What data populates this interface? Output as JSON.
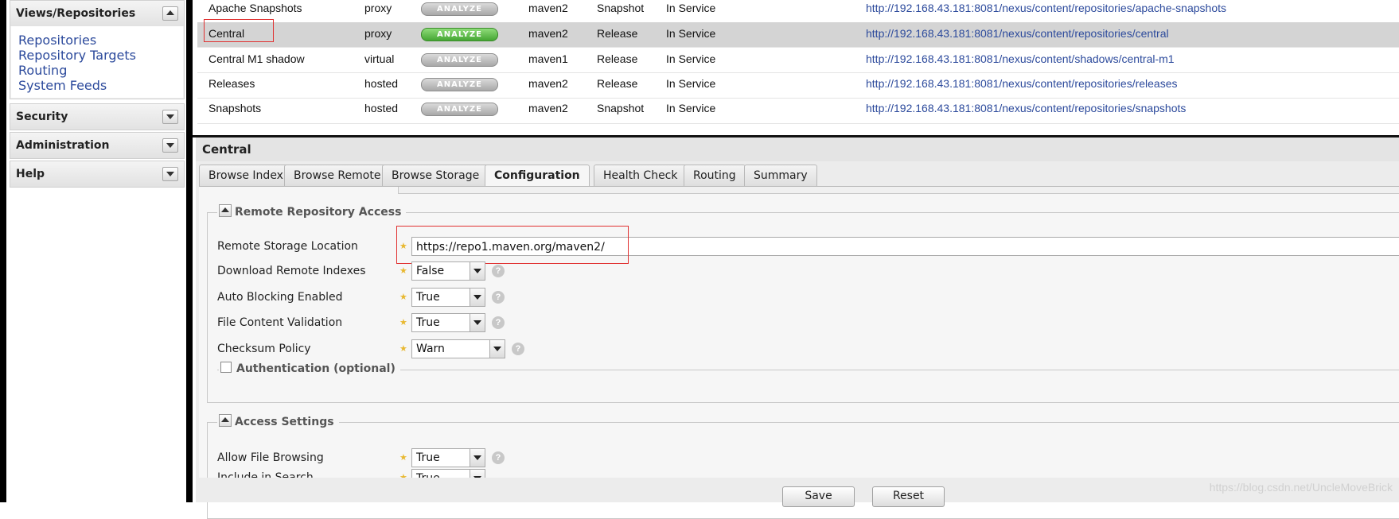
{
  "sidebar": {
    "panels": [
      {
        "title": "Views/Repositories",
        "links": [
          "Repositories",
          "Repository Targets",
          "Routing",
          "System Feeds"
        ]
      },
      {
        "title": "Security"
      },
      {
        "title": "Administration"
      },
      {
        "title": "Help"
      }
    ]
  },
  "repos": {
    "analyze_label": "ANALYZE",
    "rows": [
      {
        "name": "Apache Snapshots",
        "type": "proxy",
        "format": "maven2",
        "policy": "Snapshot",
        "status": "In Service",
        "url": "http://192.168.43.181:8081/nexus/content/repositories/apache-snapshots"
      },
      {
        "name": "Central",
        "type": "proxy",
        "format": "maven2",
        "policy": "Release",
        "status": "In Service",
        "url": "http://192.168.43.181:8081/nexus/content/repositories/central"
      },
      {
        "name": "Central M1 shadow",
        "type": "virtual",
        "format": "maven1",
        "policy": "Release",
        "status": "In Service",
        "url": "http://192.168.43.181:8081/nexus/content/shadows/central-m1"
      },
      {
        "name": "Releases",
        "type": "hosted",
        "format": "maven2",
        "policy": "Release",
        "status": "In Service",
        "url": "http://192.168.43.181:8081/nexus/content/repositories/releases"
      },
      {
        "name": "Snapshots",
        "type": "hosted",
        "format": "maven2",
        "policy": "Snapshot",
        "status": "In Service",
        "url": "http://192.168.43.181:8081/nexus/content/repositories/snapshots"
      }
    ]
  },
  "detail": {
    "title": "Central",
    "tabs": [
      "Browse Index",
      "Browse Remote",
      "Browse Storage",
      "Configuration",
      "Health Check",
      "Routing",
      "Summary"
    ],
    "remote_access": {
      "legend": "Remote Repository Access",
      "remote_storage_label": "Remote Storage Location",
      "remote_storage_value": "https://repo1.maven.org/maven2/",
      "download_indexes_label": "Download Remote Indexes",
      "download_indexes_value": "False",
      "auto_blocking_label": "Auto Blocking Enabled",
      "auto_blocking_value": "True",
      "file_validation_label": "File Content Validation",
      "file_validation_value": "True",
      "checksum_label": "Checksum Policy",
      "checksum_value": "Warn",
      "auth_legend": "Authentication (optional)"
    },
    "access_settings": {
      "legend": "Access Settings",
      "file_browsing_label": "Allow File Browsing",
      "file_browsing_value": "True",
      "include_search_label": "Include in Search",
      "include_search_value": "True"
    }
  },
  "buttons": {
    "save": "Save",
    "reset": "Reset"
  },
  "watermark": "https://blog.csdn.net/UncleMoveBrick"
}
